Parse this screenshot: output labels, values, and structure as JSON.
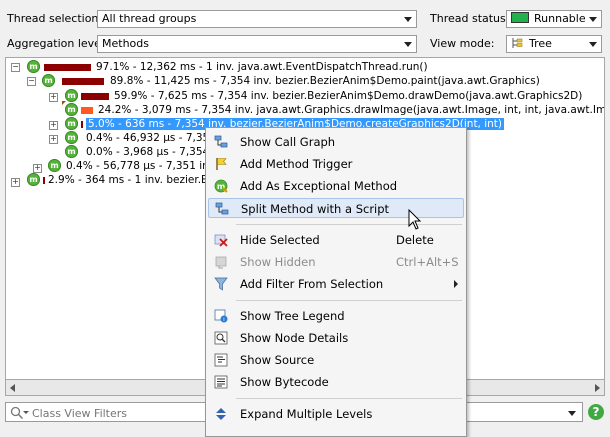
{
  "toolbar": {
    "thread_selection_label": "Thread selection:",
    "thread_selection_value": "All thread groups",
    "thread_status_label": "Thread status:",
    "thread_status_value": "Runnable",
    "aggregation_label": "Aggregation level:",
    "aggregation_value": "Methods",
    "view_mode_label": "View mode:",
    "view_mode_value": "Tree",
    "runnable_color": "#22b14c"
  },
  "tree": {
    "rows": [
      {
        "text": "97.1% - 12,362 ms - 1 inv. java.awt.EventDispatchThread.run()"
      },
      {
        "text": "89.8% - 11,425 ms - 7,354 inv. bezier.BezierAnim$Demo.paint(java.awt.Graphics)"
      },
      {
        "text": "59.9% - 7,625 ms - 7,354 inv. bezier.BezierAnim$Demo.drawDemo(java.awt.Graphics2D)"
      },
      {
        "text": "24.2% - 3,079 ms - 7,354 inv. java.awt.Graphics.drawImage(java.awt.Image, int, int, java.awt.Image.Ir"
      },
      {
        "text": "5.0% - 636 ms - 7,354 inv. bezier.BezierAnim$Demo.createGraphics2D(int, int)"
      },
      {
        "text": "0.4% - 46,932 µs - 7,35"
      },
      {
        "text": "0.0% - 3,968 µs - 7,354"
      },
      {
        "text": "0.4% - 56,778 µs - 7,351 inv"
      },
      {
        "text": "2.9% - 364 ms - 1 inv. bezier.Bez"
      }
    ]
  },
  "filter": {
    "placeholder": "Class View Filters"
  },
  "context_menu": {
    "items": [
      {
        "label": "Show Call Graph",
        "shortcut": ""
      },
      {
        "label": "Add Method Trigger",
        "shortcut": ""
      },
      {
        "label": "Add As Exceptional Method",
        "shortcut": ""
      },
      {
        "label": "Split Method with a Script",
        "shortcut": ""
      },
      {
        "label": "Hide Selected",
        "shortcut": "Delete"
      },
      {
        "label": "Show Hidden",
        "shortcut": "Ctrl+Alt+S"
      },
      {
        "label": "Add Filter From Selection",
        "shortcut": ""
      },
      {
        "label": "Show Tree Legend",
        "shortcut": ""
      },
      {
        "label": "Show Node Details",
        "shortcut": ""
      },
      {
        "label": "Show Source",
        "shortcut": ""
      },
      {
        "label": "Show Bytecode",
        "shortcut": ""
      },
      {
        "label": "Expand Multiple Levels",
        "shortcut": ""
      }
    ]
  }
}
